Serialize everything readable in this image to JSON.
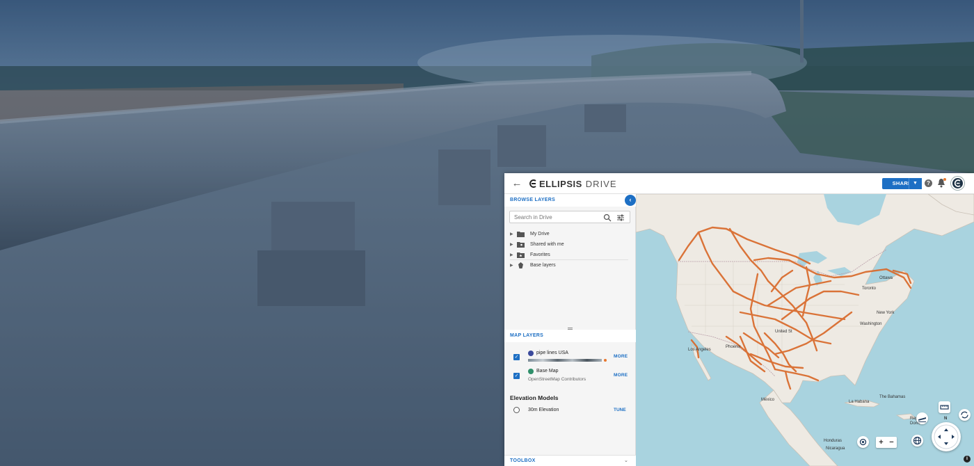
{
  "header": {
    "logo_text": "ELLIPSIS",
    "logo_sub": "DRIVE",
    "share_label": "SHARE"
  },
  "browse": {
    "title": "BROWSE LAYERS",
    "search_placeholder": "Search in Drive",
    "tree": [
      {
        "label": "My Drive",
        "icon": "folder-icon"
      },
      {
        "label": "Shared with me",
        "icon": "shared-folder-icon"
      },
      {
        "label": "Favorites",
        "icon": "favorites-folder-icon"
      },
      {
        "label": "Base layers",
        "icon": "base-layers-icon"
      }
    ]
  },
  "map_layers": {
    "title": "MAP LAYERS",
    "layers": [
      {
        "name": "pipe lines USA",
        "subtitle": "",
        "action": "MORE",
        "checked": true,
        "badge_color": "#3b4a9c"
      },
      {
        "name": "Base Map",
        "subtitle": "OpenStreetMap Contributors",
        "action": "MORE",
        "checked": true,
        "badge_color": "#2f8f6a"
      }
    ],
    "elevation_title": "Elevation Models",
    "elevation": {
      "name": "30m Elevation",
      "action": "TUNE",
      "checked": false
    }
  },
  "toolbox": {
    "title": "TOOLBOX"
  },
  "map": {
    "labels": {
      "ottawa": "Ottawa",
      "toronto": "Toronto",
      "new_york": "New York",
      "washington": "Washington",
      "los_angeles": "Los Angeles",
      "phoenix": "Phoenix",
      "united_states": "United St",
      "mexico": "México",
      "la_habana": "La Habana",
      "the_bahamas": "The Bahamas",
      "honduras": "Honduras",
      "nicaragua": "Nicaragua",
      "republica": "Repúb",
      "dominica": "Domini"
    },
    "compass_label": "N",
    "zoom_in": "+",
    "zoom_out": "−",
    "pipeline_color": "#d9692a"
  }
}
